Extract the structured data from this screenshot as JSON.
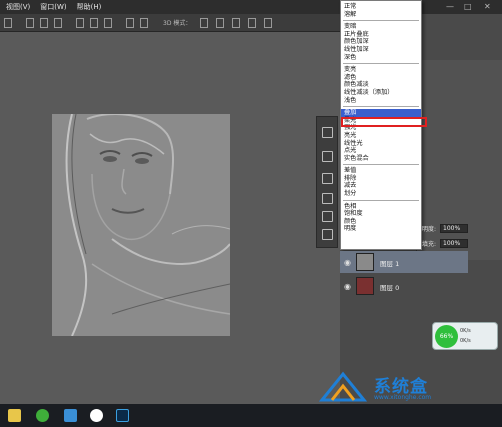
{
  "menubar": {
    "items": [
      "视图(V)",
      "窗口(W)",
      "帮助(H)"
    ]
  },
  "window_controls": {
    "minimize": "—",
    "restore": "□",
    "close": "✕"
  },
  "options_bar": {
    "mode_label": "3D 模式："
  },
  "blend_menu": {
    "groups": [
      [
        "正常",
        "溶解"
      ],
      [
        "变暗",
        "正片叠底",
        "颜色加深",
        "线性加深",
        "深色"
      ],
      [
        "变亮",
        "滤色",
        "颜色减淡",
        "线性减淡（添加）",
        "浅色"
      ],
      [
        "叠加",
        "柔光",
        "强光",
        "亮光",
        "线性光",
        "点光",
        "实色混合"
      ],
      [
        "差值",
        "排除",
        "减去",
        "划分"
      ],
      [
        "色相",
        "饱和度",
        "颜色",
        "明度"
      ]
    ],
    "selected": "叠加"
  },
  "layers_panel": {
    "opacity_label": "明度:",
    "opacity_value": "100%",
    "fill_label": "填充:",
    "fill_value": "100%",
    "layers": [
      {
        "name": "图层 1",
        "active": true
      },
      {
        "name": "图层 0",
        "active": false
      }
    ]
  },
  "speed_widget": {
    "percent": "66%",
    "up": "0K/s",
    "down": "0K/s"
  },
  "watermark": {
    "text": "系统盒",
    "url": "www.xitonghe.com"
  },
  "taskbar": {
    "icons": [
      "file-explorer-icon",
      "browser-icon",
      "photos-icon",
      "media-player-icon",
      "photoshop-icon"
    ]
  }
}
